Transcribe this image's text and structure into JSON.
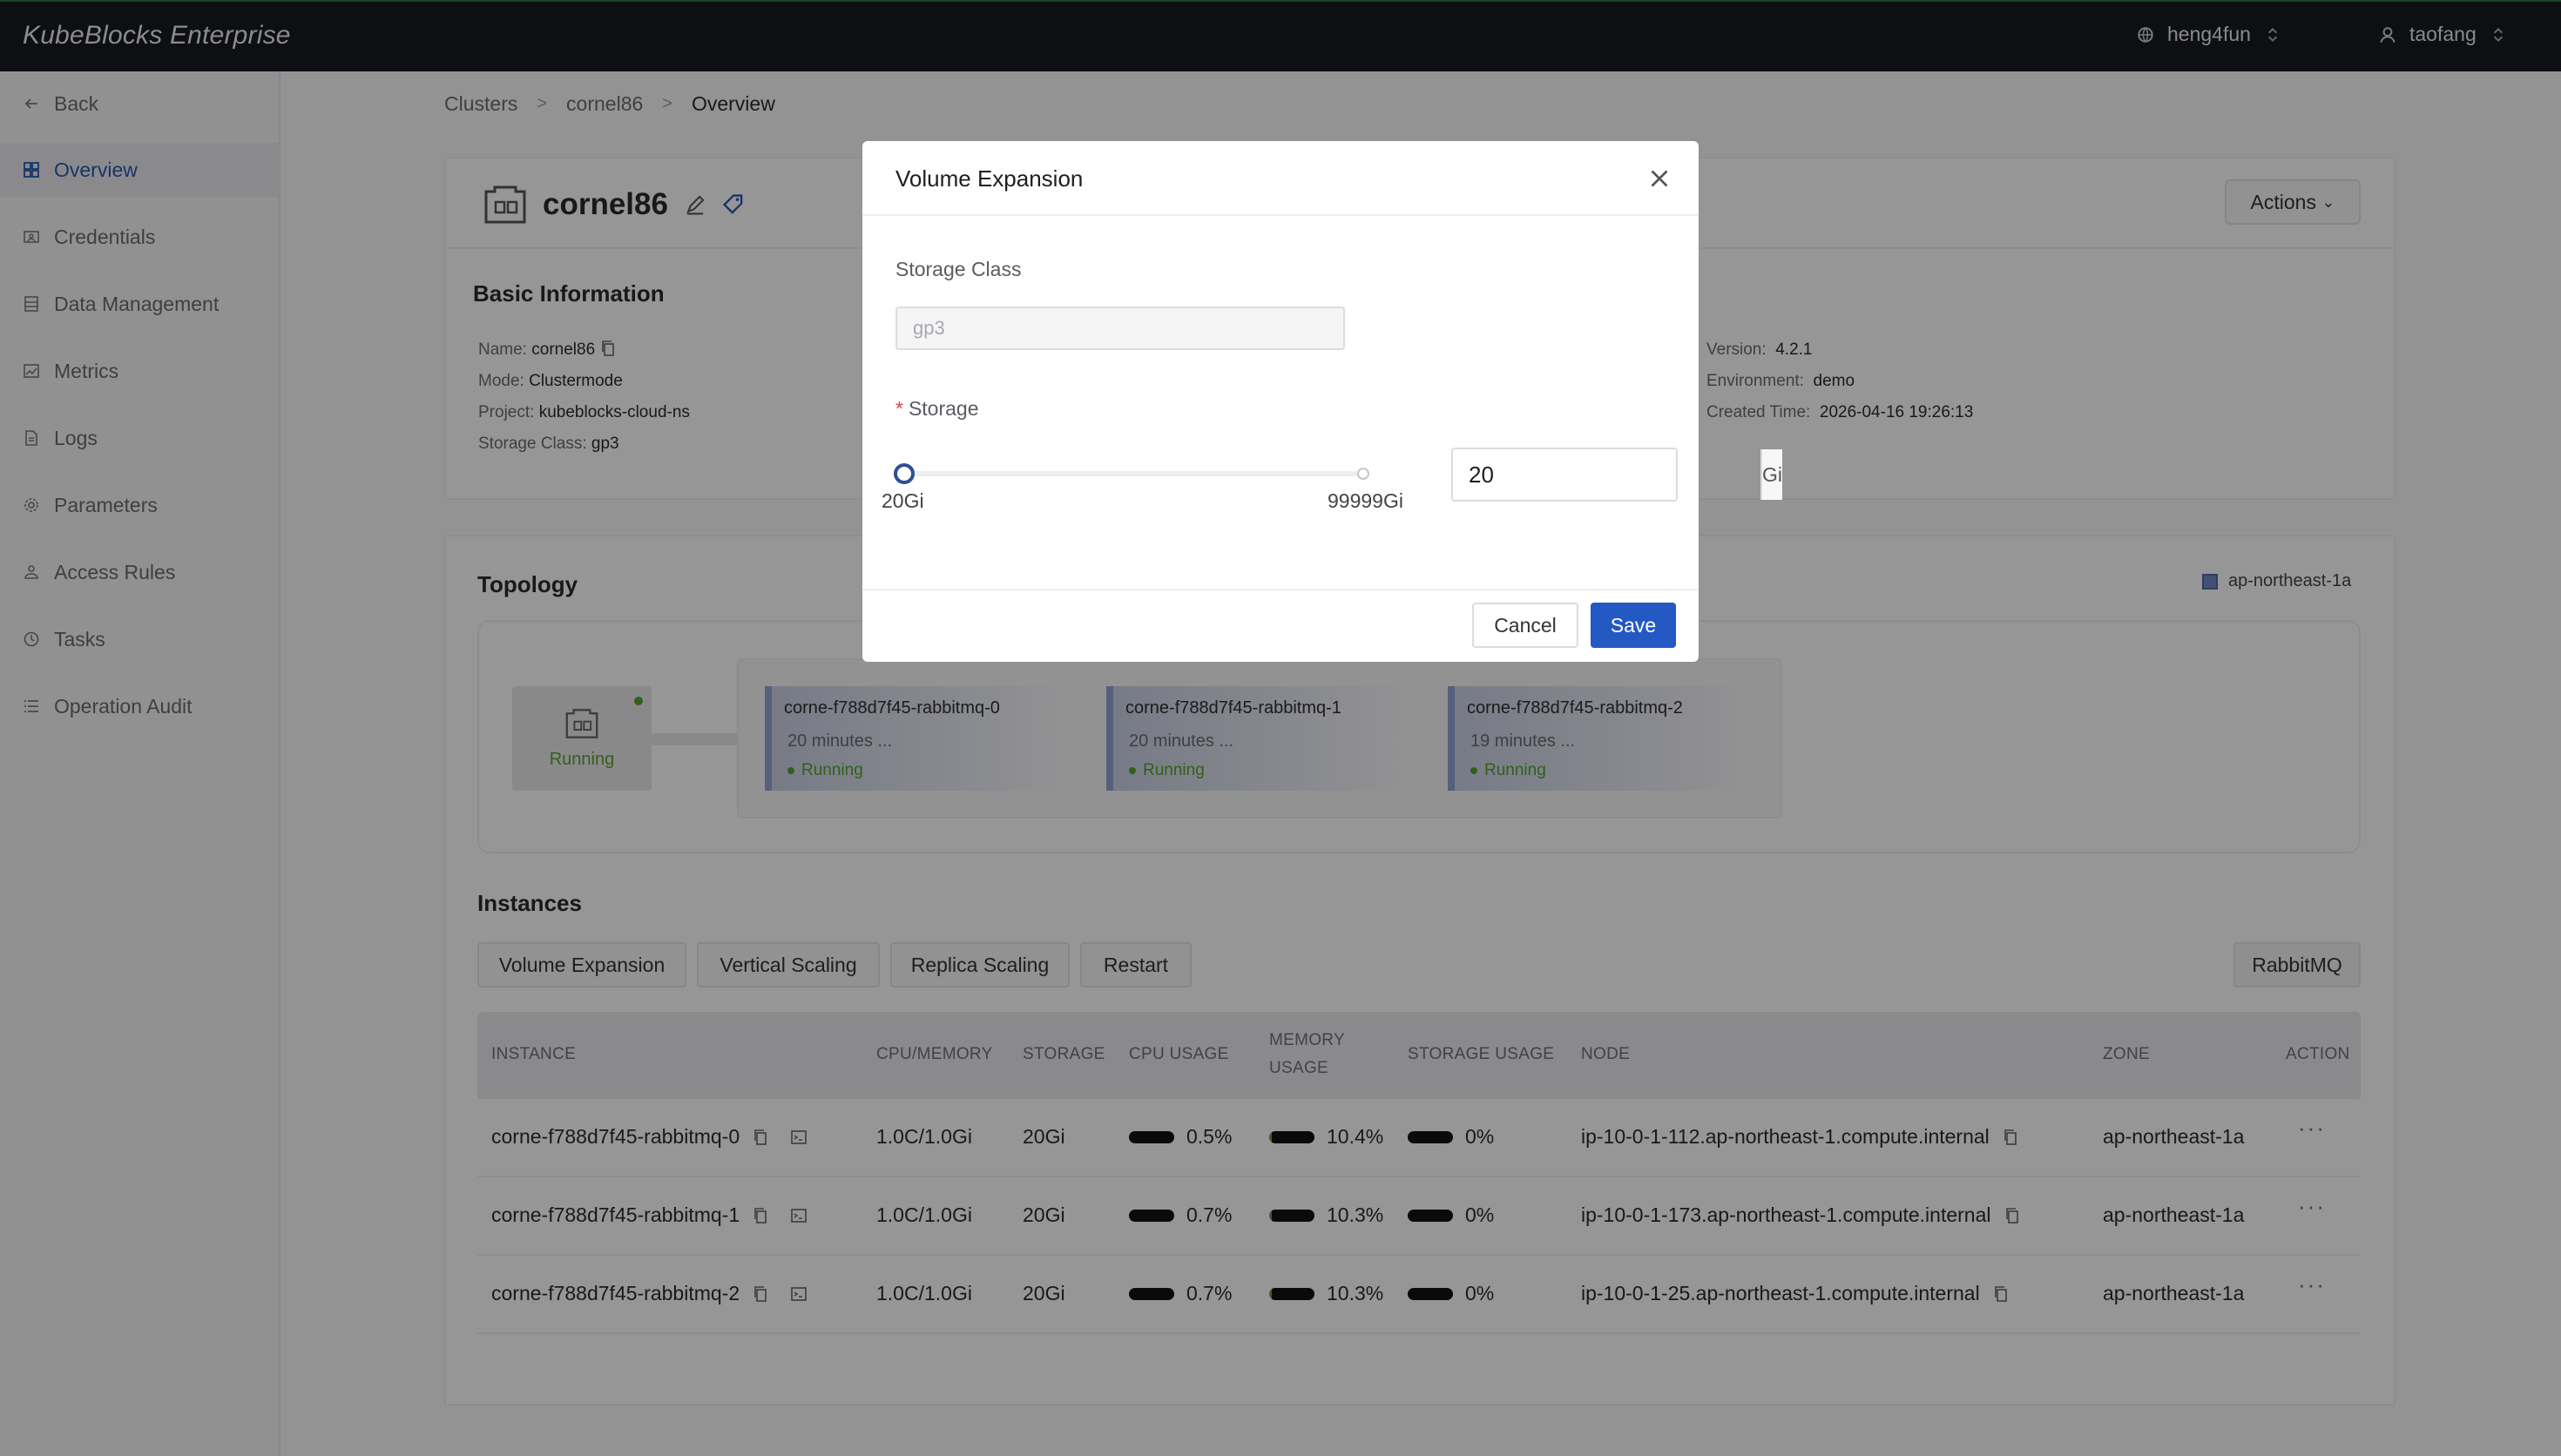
{
  "app": {
    "brand": "KubeBlocks Enterprise"
  },
  "topbar": {
    "org": "heng4fun",
    "user": "taofang"
  },
  "sidebar": {
    "back": "Back",
    "items": [
      {
        "label": "Overview",
        "icon": "grid-icon",
        "active": true
      },
      {
        "label": "Credentials",
        "icon": "id-card-icon"
      },
      {
        "label": "Data Management",
        "icon": "database-icon"
      },
      {
        "label": "Metrics",
        "icon": "chart-icon"
      },
      {
        "label": "Logs",
        "icon": "file-icon"
      },
      {
        "label": "Parameters",
        "icon": "gear-icon"
      },
      {
        "label": "Access Rules",
        "icon": "people-icon"
      },
      {
        "label": "Tasks",
        "icon": "clock-icon"
      },
      {
        "label": "Operation Audit",
        "icon": "list-icon"
      }
    ]
  },
  "breadcrumb": [
    "Clusters",
    "cornel86",
    "Overview"
  ],
  "cluster": {
    "name": "cornel86",
    "actions_label": "Actions"
  },
  "basic": {
    "title": "Basic Information",
    "left": [
      {
        "k": "Name:",
        "v": "cornel86"
      },
      {
        "k": "Mode:",
        "v": "Clustermode"
      },
      {
        "k": "Project:",
        "v": "kubeblocks-cloud-ns"
      },
      {
        "k": "Storage Class:",
        "v": "gp3"
      }
    ],
    "right": [
      {
        "k": "Version:",
        "v": "4.2.1"
      },
      {
        "k": "Environment:",
        "v": "demo"
      },
      {
        "k": "Created Time:",
        "v": "2026-04-16 19:26:13"
      }
    ]
  },
  "topology": {
    "title": "Topology",
    "zone": "ap-northeast-1a",
    "cluster_status": "Running",
    "pods": [
      {
        "name": "corne-f788d7f45-rabbitmq-0",
        "age": "20 minutes ...",
        "status": "Running"
      },
      {
        "name": "corne-f788d7f45-rabbitmq-1",
        "age": "20 minutes ...",
        "status": "Running"
      },
      {
        "name": "corne-f788d7f45-rabbitmq-2",
        "age": "19 minutes ...",
        "status": "Running"
      }
    ]
  },
  "instances": {
    "title": "Instances",
    "tabs": [
      "Volume Expansion",
      "Vertical Scaling",
      "Replica Scaling",
      "Restart"
    ],
    "component": "RabbitMQ",
    "columns": [
      "INSTANCE",
      "CPU/MEMORY",
      "STORAGE",
      "CPU USAGE",
      "MEMORY",
      "USAGE",
      "STORAGE USAGE",
      "NODE",
      "ZONE",
      "ACTION"
    ],
    "rows": [
      {
        "instance": "corne-f788d7f45-rabbitmq-0",
        "cpumem": "1.0C/1.0Gi",
        "storage": "20Gi",
        "cpu": "0.5%",
        "mem": "10.4%",
        "disk": "0%",
        "node": "ip-10-0-1-112.ap-northeast-1.compute.internal",
        "zone": "ap-northeast-1a",
        "more": "···"
      },
      {
        "instance": "corne-f788d7f45-rabbitmq-1",
        "cpumem": "1.0C/1.0Gi",
        "storage": "20Gi",
        "cpu": "0.7%",
        "mem": "10.3%",
        "disk": "0%",
        "node": "ip-10-0-1-173.ap-northeast-1.compute.internal",
        "zone": "ap-northeast-1a",
        "more": "···"
      },
      {
        "instance": "corne-f788d7f45-rabbitmq-2",
        "cpumem": "1.0C/1.0Gi",
        "storage": "20Gi",
        "cpu": "0.7%",
        "mem": "10.3%",
        "disk": "0%",
        "node": "ip-10-0-1-25.ap-northeast-1.compute.internal",
        "zone": "ap-northeast-1a",
        "more": "···"
      }
    ]
  },
  "modal": {
    "title": "Volume Expansion",
    "storage_class_label": "Storage Class",
    "storage_class_placeholder": "gp3",
    "storage_label": "Storage",
    "required_mark": "*",
    "slider_min": "20Gi",
    "slider_max": "99999Gi",
    "storage_value": "20",
    "unit": "Gi",
    "cancel": "Cancel",
    "save": "Save"
  },
  "colors": {
    "primary": "#2459c3",
    "topbar": "#16191f",
    "running": "#52a12b",
    "zone": "#6f86c4"
  }
}
